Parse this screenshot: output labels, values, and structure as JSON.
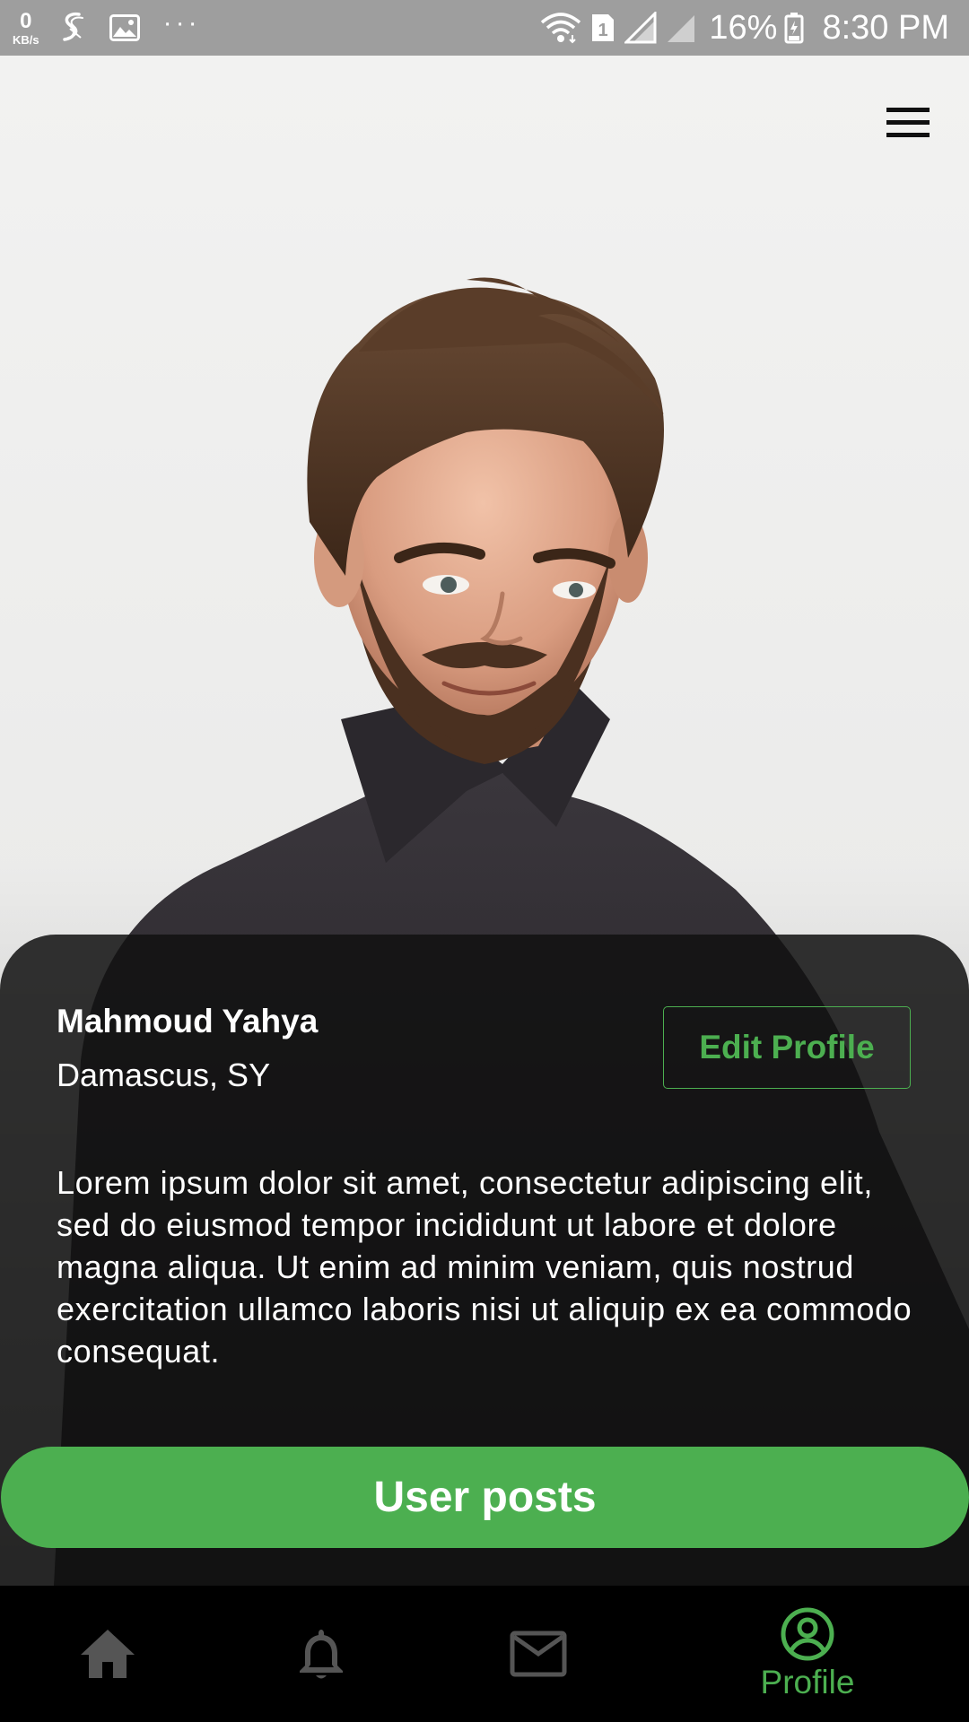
{
  "status_bar": {
    "data_rate_value": "0",
    "data_rate_unit": "KB/s",
    "sim_slot": "1",
    "battery_percent": "16%",
    "time": "8:30 PM"
  },
  "header": {
    "menu_icon": "hamburger-menu-icon"
  },
  "profile": {
    "name": "Mahmoud Yahya",
    "location": "Damascus, SY",
    "edit_label": "Edit Profile",
    "bio": "Lorem ipsum dolor sit amet, consectetur adipiscing elit, sed do eiusmod tempor incididunt ut labore et dolore magna aliqua. Ut enim ad minim veniam, quis nostrud exercitation ullamco laboris nisi ut aliquip ex ea commodo consequat.",
    "posts_label": "User posts"
  },
  "bottom_nav": {
    "items": [
      {
        "icon": "home-icon",
        "label": ""
      },
      {
        "icon": "bell-icon",
        "label": ""
      },
      {
        "icon": "mail-icon",
        "label": ""
      },
      {
        "icon": "account-circle-icon",
        "label": "Profile",
        "active": true
      }
    ]
  },
  "colors": {
    "accent": "#4caf50",
    "card_bg": "#121212",
    "status_bar_bg": "#9e9e9e",
    "inactive_icon": "#555555"
  }
}
